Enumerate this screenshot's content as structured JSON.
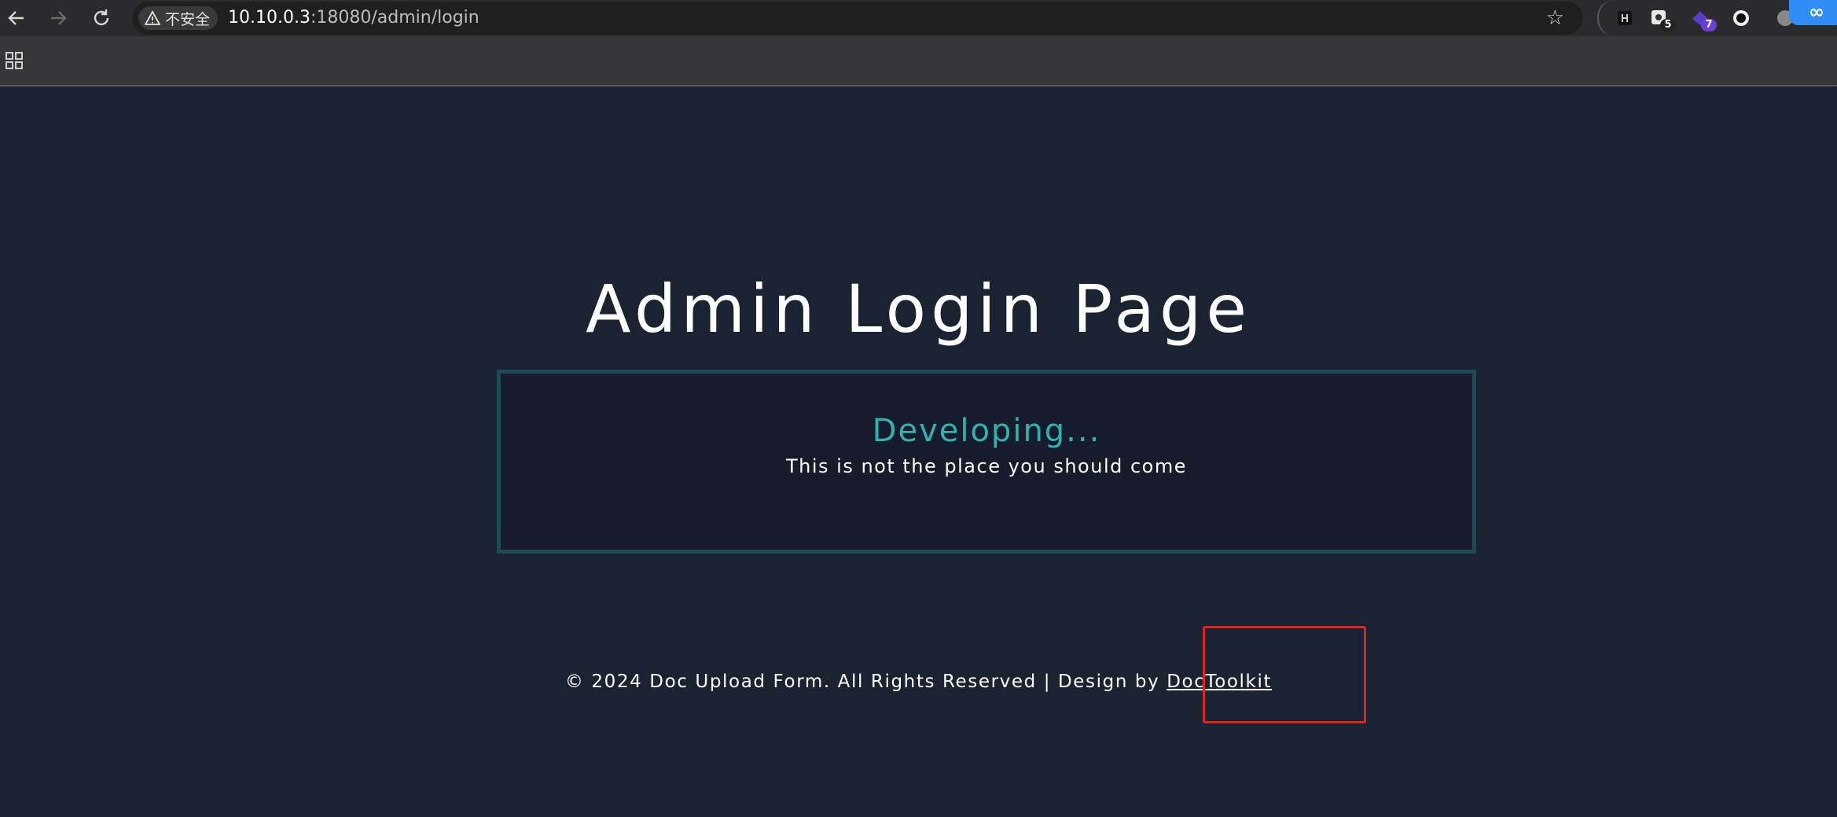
{
  "browser": {
    "security_label": "不安全",
    "url_host": "10.10.0.3",
    "url_rest": ":18080/admin/login",
    "extensions": [
      {
        "name": "h-extension",
        "badge": ""
      },
      {
        "name": "image-extension",
        "badge": "5"
      },
      {
        "name": "purple-extension",
        "badge": "7"
      },
      {
        "name": "circle-extension",
        "badge": ""
      }
    ],
    "colors": {
      "chip_bg": "#3a3a3c",
      "omnibox_bg": "#1f1f20"
    }
  },
  "page": {
    "title": "Admin Login Page",
    "card": {
      "heading": "Developing...",
      "message": "This is not the place you should come"
    },
    "footer": {
      "text": "© 2024 Doc Upload Form. All Rights Reserved | Design by ",
      "link": "DocToolkit"
    },
    "colors": {
      "background": "#1b2232",
      "card_border": "#1c4a55",
      "heading": "#2fb3b0",
      "highlight": "#e0251f"
    }
  }
}
